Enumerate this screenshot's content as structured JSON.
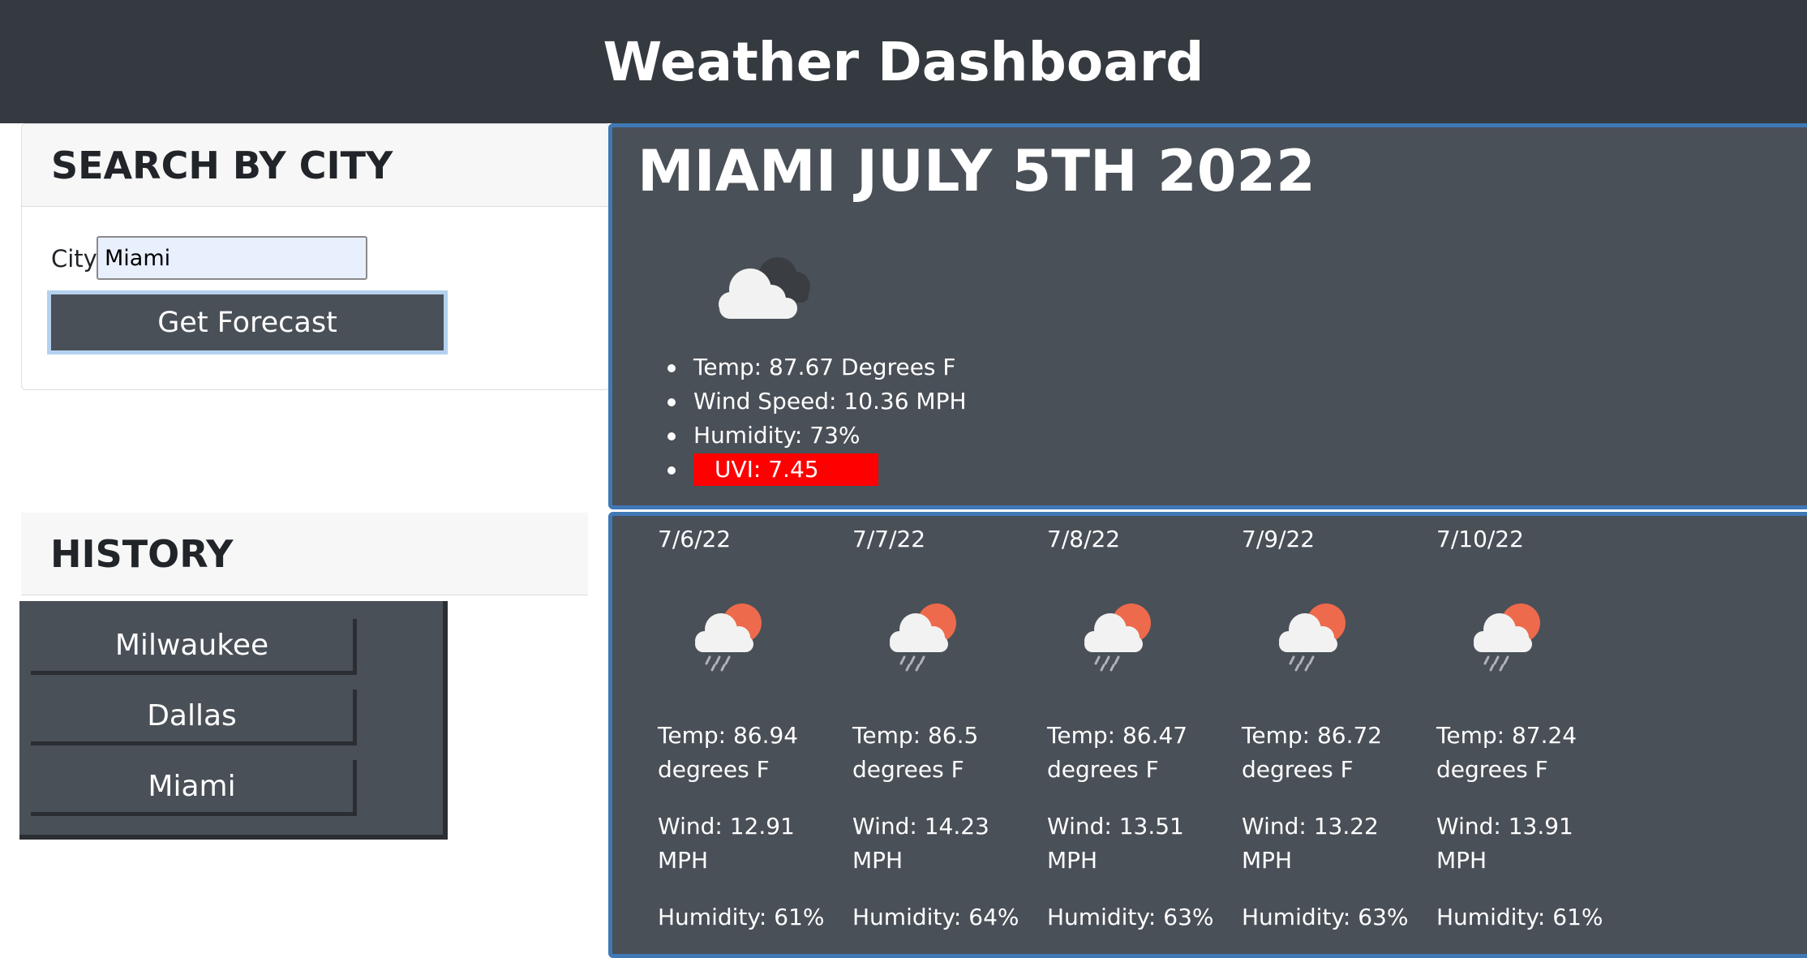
{
  "header": {
    "title": "Weather Dashboard"
  },
  "search": {
    "heading": "SEARCH BY CITY",
    "city_label": "City",
    "city_value": "Miami",
    "button_label": "Get Forecast"
  },
  "history": {
    "heading": "HISTORY",
    "items": [
      "Milwaukee",
      "Dallas",
      "Miami"
    ]
  },
  "current": {
    "title": "MIAMI JULY 5TH 2022",
    "icon": "broken-clouds-icon",
    "temp": "Temp: 87.67 Degrees F",
    "wind": "Wind Speed: 10.36 MPH",
    "humidity": "Humidity: 73%",
    "uvi": "UVI: 7.45",
    "uvi_color": "#ff0000"
  },
  "forecast": [
    {
      "date": "7/6/22",
      "icon": "rain-sun-icon",
      "temp_value": "Temp: 86.94",
      "temp_unit": "degrees F",
      "wind_value": "Wind: 12.91",
      "wind_unit": "MPH",
      "humidity": "Humidity: 61%"
    },
    {
      "date": "7/7/22",
      "icon": "rain-sun-icon",
      "temp_value": "Temp: 86.5",
      "temp_unit": "degrees F",
      "wind_value": "Wind: 14.23",
      "wind_unit": "MPH",
      "humidity": "Humidity: 64%"
    },
    {
      "date": "7/8/22",
      "icon": "rain-sun-icon",
      "temp_value": "Temp: 86.47",
      "temp_unit": "degrees F",
      "wind_value": "Wind: 13.51",
      "wind_unit": "MPH",
      "humidity": "Humidity: 63%"
    },
    {
      "date": "7/9/22",
      "icon": "rain-sun-icon",
      "temp_value": "Temp: 86.72",
      "temp_unit": "degrees F",
      "wind_value": "Wind: 13.22",
      "wind_unit": "MPH",
      "humidity": "Humidity: 63%"
    },
    {
      "date": "7/10/22",
      "icon": "rain-sun-icon",
      "temp_value": "Temp: 87.24",
      "temp_unit": "degrees F",
      "wind_value": "Wind: 13.91",
      "wind_unit": "MPH",
      "humidity": "Humidity: 61%"
    }
  ],
  "colors": {
    "header_bg": "#343a40",
    "panel_bg": "#4a5058",
    "panel_border": "#3f78b5",
    "sun": "#ee6a4c"
  }
}
